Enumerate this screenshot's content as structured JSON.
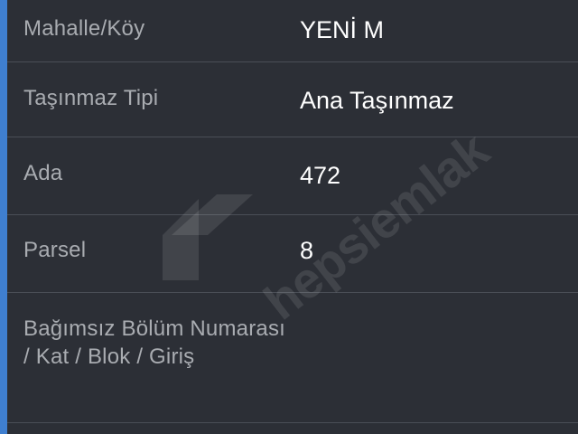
{
  "details": {
    "rows": [
      {
        "label": "Mahalle/Köy",
        "value": "YENİ M"
      },
      {
        "label": "Taşınmaz Tipi",
        "value": "Ana Taşınmaz"
      },
      {
        "label": "Ada",
        "value": "472"
      },
      {
        "label": "Parsel",
        "value": "8"
      },
      {
        "label": "Bağımsız Bölüm Numarası / Kat / Blok / Giriş",
        "value": ""
      }
    ]
  },
  "watermark": {
    "text": "hepsiemlak"
  },
  "colors": {
    "background": "#2c2f36",
    "accent": "#3f7fd0",
    "label": "#a9acb1",
    "value": "#ffffff",
    "divider": "#4a4e56"
  }
}
